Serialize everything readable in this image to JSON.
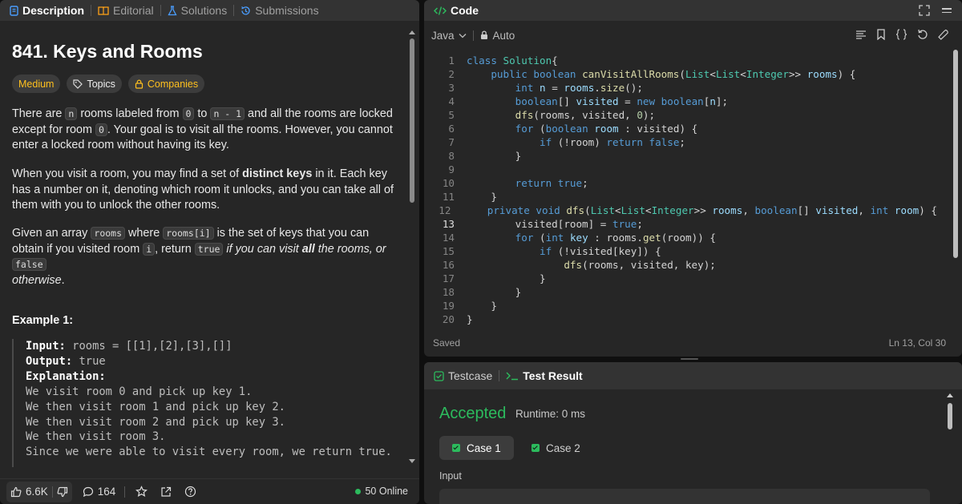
{
  "left_tabs": {
    "description": "Description",
    "editorial": "Editorial",
    "solutions": "Solutions",
    "submissions": "Submissions"
  },
  "problem": {
    "title": "841. Keys and Rooms",
    "difficulty": "Medium",
    "topics": "Topics",
    "companies": "Companies",
    "p1": {
      "t1": "There are ",
      "c1": "n",
      "t2": " rooms labeled from ",
      "c2": "0",
      "t3": " to ",
      "c3": "n - 1",
      "t4": " and all the rooms are locked except for room ",
      "c4": "0",
      "t5": ". Your goal is to visit all the rooms. However, you cannot enter a locked room without having its key."
    },
    "p2": {
      "t1": "When you visit a room, you may find a set of ",
      "b1": "distinct keys",
      "t2": " in it. Each key has a number on it, denoting which room it unlocks, and you can take all of them with you to unlock the other rooms."
    },
    "p3": {
      "t1": "Given an array ",
      "c1": "rooms",
      "t2": " where ",
      "c2": "rooms[i]",
      "t3": " is the set of keys that you can obtain if you visited room ",
      "c3": "i",
      "t4": ", return ",
      "c4": "true",
      "i1": " if you can visit ",
      "b1": "all",
      "i2": " the rooms, or ",
      "c5": "false",
      "i3": "otherwise",
      "t5": "."
    },
    "example_title": "Example 1:",
    "example": {
      "input_label": "Input:",
      "input_value": " rooms = [[1],[2],[3],[]]",
      "output_label": "Output:",
      "output_value": " true",
      "explanation_label": "Explanation:",
      "lines": [
        "We visit room 0 and pick up key 1.",
        "We then visit room 1 and pick up key 2.",
        "We then visit room 2 and pick up key 3.",
        "We then visit room 3.",
        "Since we were able to visit every room, we return true."
      ]
    }
  },
  "bottom": {
    "likes": "6.6K",
    "comments": "164",
    "online": "50 Online"
  },
  "code_panel": {
    "title": "Code",
    "language": "Java",
    "mode": "Auto",
    "status_left": "Saved",
    "status_right": "Ln 13, Col 30",
    "current_line": 13,
    "lines": [
      [
        [
          "kw",
          "class "
        ],
        [
          "ty",
          "Solution"
        ],
        [
          "",
          "{"
        ]
      ],
      [
        [
          "",
          "    "
        ],
        [
          "kw",
          "public boolean "
        ],
        [
          "fn",
          "canVisitAllRooms"
        ],
        [
          "",
          "("
        ],
        [
          "ty",
          "List"
        ],
        [
          "",
          "<"
        ],
        [
          "ty",
          "List"
        ],
        [
          "",
          "<"
        ],
        [
          "ty",
          "Integer"
        ],
        [
          "",
          ">> "
        ],
        [
          "va",
          "rooms"
        ],
        [
          "",
          ") {"
        ]
      ],
      [
        [
          "",
          "        "
        ],
        [
          "kw",
          "int "
        ],
        [
          "va",
          "n"
        ],
        [
          "",
          " = "
        ],
        [
          "va",
          "rooms"
        ],
        [
          "",
          "."
        ],
        [
          "fn",
          "size"
        ],
        [
          "",
          "();"
        ]
      ],
      [
        [
          "",
          "        "
        ],
        [
          "kw",
          "boolean"
        ],
        [
          "",
          "[] "
        ],
        [
          "va",
          "visited"
        ],
        [
          "",
          " = "
        ],
        [
          "kw",
          "new boolean"
        ],
        [
          "",
          "["
        ],
        [
          "va",
          "n"
        ],
        [
          "",
          "];"
        ]
      ],
      [
        [
          "",
          "        "
        ],
        [
          "fn",
          "dfs"
        ],
        [
          "",
          "(rooms, visited, "
        ],
        [
          "nu",
          "0"
        ],
        [
          "",
          ");"
        ]
      ],
      [
        [
          "",
          "        "
        ],
        [
          "kw",
          "for "
        ],
        [
          "",
          "("
        ],
        [
          "kw",
          "boolean "
        ],
        [
          "va",
          "room"
        ],
        [
          "",
          " : visited) {"
        ]
      ],
      [
        [
          "",
          "            "
        ],
        [
          "kw",
          "if "
        ],
        [
          "",
          "(!room) "
        ],
        [
          "kw",
          "return false"
        ],
        [
          "",
          ";"
        ]
      ],
      [
        [
          "",
          "        }"
        ]
      ],
      [
        [
          "",
          ""
        ]
      ],
      [
        [
          "",
          "        "
        ],
        [
          "kw",
          "return true"
        ],
        [
          "",
          ";"
        ]
      ],
      [
        [
          "",
          "    }"
        ]
      ],
      [
        [
          "",
          "    "
        ],
        [
          "kw",
          "private void "
        ],
        [
          "fn",
          "dfs"
        ],
        [
          "",
          "("
        ],
        [
          "ty",
          "List"
        ],
        [
          "",
          "<"
        ],
        [
          "ty",
          "List"
        ],
        [
          "",
          "<"
        ],
        [
          "ty",
          "Integer"
        ],
        [
          "",
          ">> "
        ],
        [
          "va",
          "rooms"
        ],
        [
          "",
          ", "
        ],
        [
          "kw",
          "boolean"
        ],
        [
          "",
          "[] "
        ],
        [
          "va",
          "visited"
        ],
        [
          "",
          ", "
        ],
        [
          "kw",
          "int "
        ],
        [
          "va",
          "room"
        ],
        [
          "",
          ") {"
        ]
      ],
      [
        [
          "",
          "        visited[room] = "
        ],
        [
          "kw",
          "true"
        ],
        [
          "",
          ";"
        ]
      ],
      [
        [
          "",
          "        "
        ],
        [
          "kw",
          "for "
        ],
        [
          "",
          "("
        ],
        [
          "kw",
          "int "
        ],
        [
          "va",
          "key"
        ],
        [
          "",
          " : rooms."
        ],
        [
          "fn",
          "get"
        ],
        [
          "",
          "(room)) {"
        ]
      ],
      [
        [
          "",
          "            "
        ],
        [
          "kw",
          "if "
        ],
        [
          "",
          "(!visited[key]) {"
        ]
      ],
      [
        [
          "",
          "                "
        ],
        [
          "fn",
          "dfs"
        ],
        [
          "",
          "(rooms, visited, key);"
        ]
      ],
      [
        [
          "",
          "            }"
        ]
      ],
      [
        [
          "",
          "        }"
        ]
      ],
      [
        [
          "",
          "    }"
        ]
      ],
      [
        [
          "",
          "}"
        ]
      ]
    ]
  },
  "test_panel": {
    "tab_testcase": "Testcase",
    "tab_result": "Test Result",
    "status": "Accepted",
    "runtime": "Runtime: 0 ms",
    "case1": "Case 1",
    "case2": "Case 2",
    "input_label": "Input"
  },
  "colors": {
    "accent_green": "#2cbb5d",
    "medium": "#ffc01e"
  }
}
